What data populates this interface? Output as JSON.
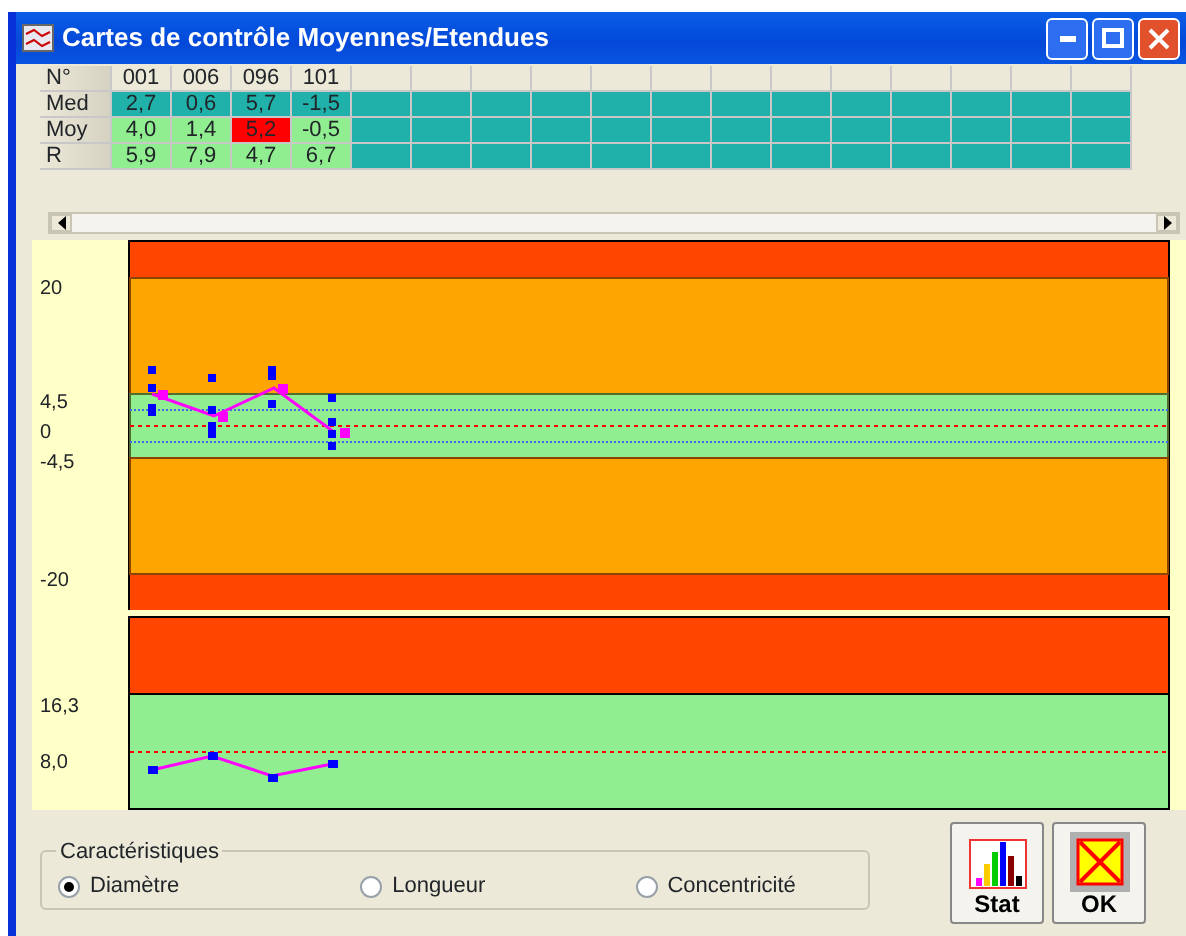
{
  "window": {
    "title": "Cartes de contrôle Moyennes/Etendues"
  },
  "table": {
    "columns": [
      "N°",
      "001",
      "006",
      "096",
      "101"
    ],
    "rows": [
      {
        "cells": [
          {
            "value": "Med"
          },
          {
            "value": "2,7",
            "color": "#20b2aa"
          },
          {
            "value": "0,6",
            "color": "#20b2aa"
          },
          {
            "value": "5,7",
            "color": "#20b2aa"
          },
          {
            "value": "-1,5",
            "color": "#20b2aa"
          }
        ]
      },
      {
        "cells": [
          {
            "value": "Moy"
          },
          {
            "value": "4,0",
            "color": "#90ee90"
          },
          {
            "value": "1,4",
            "color": "#90ee90"
          },
          {
            "value": "5,2",
            "color": "#ff0000"
          },
          {
            "value": "-0,5",
            "color": "#90ee90"
          }
        ]
      },
      {
        "cells": [
          {
            "value": "R"
          },
          {
            "value": "5,9",
            "color": "#90ee90"
          },
          {
            "value": "7,9",
            "color": "#90ee90"
          },
          {
            "value": "4,7",
            "color": "#90ee90"
          },
          {
            "value": "6,7",
            "color": "#90ee90"
          }
        ]
      }
    ]
  },
  "mean_chart": {
    "axis_labels": [
      "20",
      "4,5",
      "0",
      "-4,5",
      "-20"
    ]
  },
  "range_chart": {
    "axis_labels": [
      "16,3",
      "8,0"
    ]
  },
  "characteristics": {
    "title": "Caractéristiques",
    "options": [
      {
        "label": "Diamètre",
        "selected": true
      },
      {
        "label": "Longueur",
        "selected": false
      },
      {
        "label": "Concentricité",
        "selected": false
      }
    ]
  },
  "buttons": [
    {
      "label": "Stat",
      "kind": "stat"
    },
    {
      "label": "OK",
      "kind": "ok"
    }
  ]
}
